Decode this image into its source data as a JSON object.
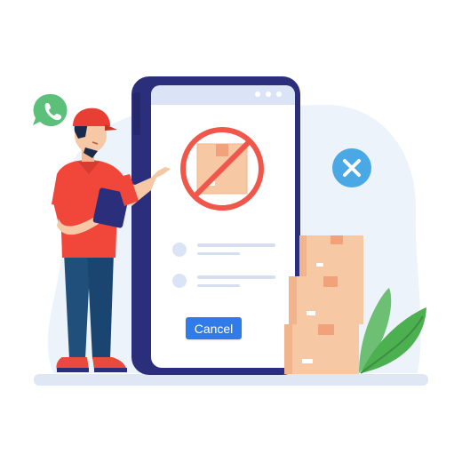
{
  "screen": {
    "cancel_label": "Cancel"
  },
  "icons": [
    "phone-call-icon",
    "close-circle-icon",
    "no-package-icon"
  ],
  "colors": {
    "background_blob": "#edf3fb",
    "phone_frame": "#2b2e7a",
    "phone_screen": "#ffffff",
    "cancel_button": "#2f7bea",
    "prohibited_sign": "#f0564a",
    "close_badge": "#4aa8e4",
    "phone_badge": "#5cc07a",
    "boxes": "#f7c8a4",
    "uniform": "#f0473a",
    "leaves": "#4caf50"
  }
}
